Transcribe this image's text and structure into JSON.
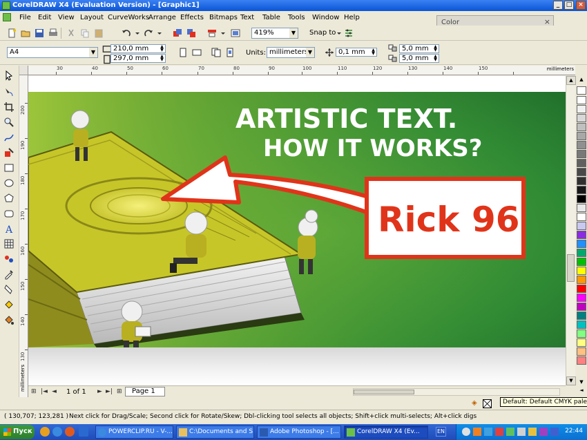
{
  "window": {
    "title": "CorelDRAW X4 (Evaluation Version) - [Graphic1]",
    "controls": [
      "_",
      "□",
      "×"
    ]
  },
  "menu": [
    "File",
    "Edit",
    "View",
    "Layout",
    "CurveWorks",
    "Arrange",
    "Effects",
    "Bitmaps",
    "Text",
    "Table",
    "Tools",
    "Window",
    "Help"
  ],
  "docker": {
    "title": "Color",
    "close": "×"
  },
  "toolbar1": {
    "zoom": "419%",
    "snap_to": "Snap to"
  },
  "toolbar2": {
    "paper_size": "A4",
    "width": "210,0 mm",
    "height": "297,0 mm",
    "units_label": "Units:",
    "units": "millimeters",
    "nudge": "0,1 mm",
    "dup_x": "5,0 mm",
    "dup_y": "5,0 mm"
  },
  "rulers": {
    "h_ticks": [
      "30",
      "40",
      "50",
      "60",
      "70",
      "80",
      "90",
      "100",
      "110",
      "120",
      "130",
      "140",
      "150"
    ],
    "h_unit": "millimeters",
    "v_ticks": [
      "200",
      "190",
      "180",
      "170",
      "160",
      "150",
      "140",
      "130"
    ],
    "v_unit": "millimeters"
  },
  "artwork": {
    "headline_line1": "ARTISTIC TEXT.",
    "headline_line2": "HOW IT WORKS?",
    "signature": "Rick 96"
  },
  "colors": {
    "bg_dark": "#1f6b2a",
    "bg_light": "#8fbf3a",
    "book": "#c7c628",
    "accent_red": "#e0341a",
    "palette": [
      "#ffffff",
      "#f0f0f0",
      "#d8d8d8",
      "#c0c0c0",
      "#a8a8a8",
      "#909090",
      "#787878",
      "#606060",
      "#484848",
      "#303030",
      "#181818",
      "#000000",
      "#e8e8e8",
      "#ffffff",
      "#c8c8f0",
      "#8a2be2",
      "#1e90ff",
      "#00a86b",
      "#00c000",
      "#ffff00",
      "#ff9900",
      "#ff0000",
      "#ff00ff",
      "#c000c0",
      "#008080",
      "#00c0c0",
      "#80ff80",
      "#ffff80",
      "#ffc080",
      "#ff8080"
    ]
  },
  "navigator": {
    "page_count": "1 of 1",
    "page_tab": "Page 1"
  },
  "tooltip": "Default: Default CMYK palette",
  "status": {
    "coords": "( 130,707; 123,281 )",
    "hint": "Next click for Drag/Scale; Second click for Rotate/Skew; Dbl-clicking tool selects all objects; Shift+click multi-selects; Alt+click digs"
  },
  "taskbar": {
    "start": "Пуск",
    "tasks": [
      "POWERCLIP.RU - V-...",
      "C:\\Documents and S...",
      "Adobe Photoshop - [...",
      "CorelDRAW X4 (Ev..."
    ],
    "lang": "EN",
    "clock": "22:44"
  }
}
